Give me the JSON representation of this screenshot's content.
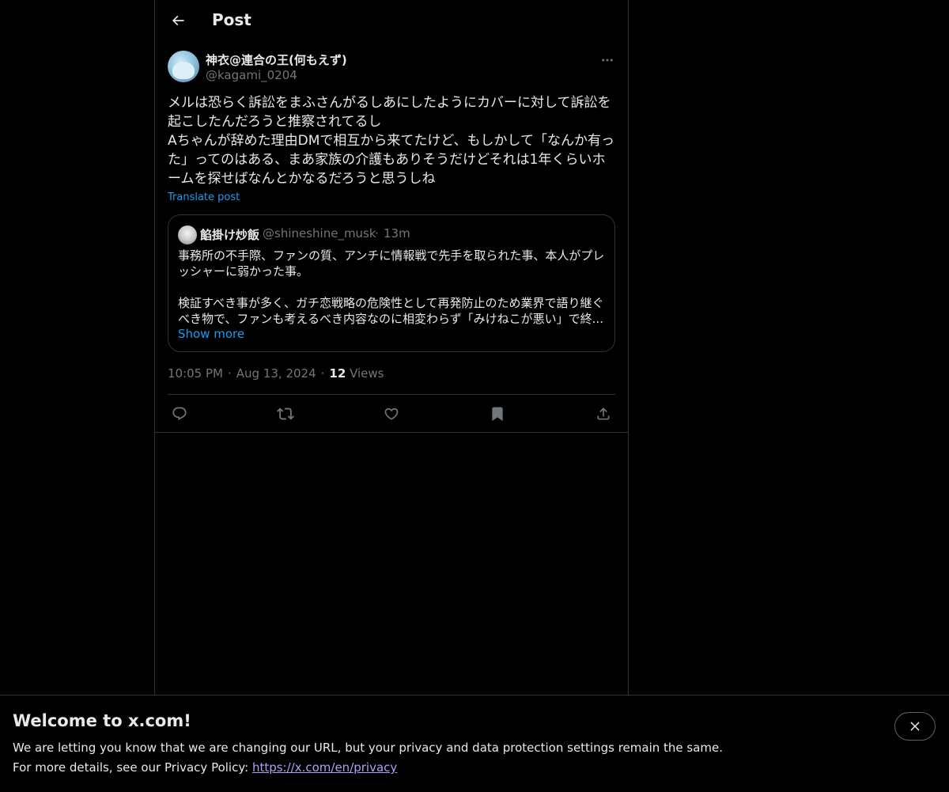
{
  "header": {
    "title": "Post",
    "back_icon": "arrow-left-icon"
  },
  "post": {
    "author": {
      "display_name": "神衣@連合の王(何もえず)",
      "handle": "@kagami_0204"
    },
    "text": "メルは恐らく訴訟をまふさんがるしあにしたようにカバーに対して訴訟を\n起こしたんだろうと推察されてるし\nAちゃんが辞めた理由DMで相互から来てたけど、もしかして「なんか有っ\nた」ってのはある、まあ家族の介護もありそうだけどそれは1年くらいホ\nームを探せばなんとかなるだろうと思うしね",
    "translate_label": "Translate post",
    "time": "10:05 PM",
    "date": "Aug 13, 2024",
    "views_count": "12",
    "views_label": "Views",
    "separator": "·"
  },
  "quote": {
    "display_name": "餡掛け炒飯",
    "handle": "@shineshine_musk",
    "separator": "·",
    "time": "13m",
    "text": "事務所の不手際、ファンの質、アンチに情報戦で先手を取られた事、本人がプレ\nッシャーに弱かった事。\n\n検証すべき事が多く、ガチ恋戦略の危険性として再発防止のため業界で語り継ぐ\nべき物で、ファンも考えるべき内容なのに相変わらず「みけねこが悪い」で終...",
    "show_more_label": "Show more"
  },
  "actions": [
    {
      "name": "reply",
      "icon": "reply-icon"
    },
    {
      "name": "repost",
      "icon": "repost-icon"
    },
    {
      "name": "like",
      "icon": "heart-icon"
    },
    {
      "name": "bookmark",
      "icon": "bookmark-icon"
    },
    {
      "name": "share",
      "icon": "share-icon"
    }
  ],
  "banner": {
    "title": "Welcome to x.com!",
    "line1": "We are letting you know that we are changing our URL, but your privacy and data protection settings remain the same.",
    "line2_prefix": "For more details, see our Privacy Policy: ",
    "privacy_link": "https://x.com/en/privacy"
  },
  "colors": {
    "background": "#000000",
    "text": "#e7e9ea",
    "muted": "#71767b",
    "accent": "#1d9bf0",
    "border": "#2f3336",
    "link_visited": "#a9a3f7"
  }
}
